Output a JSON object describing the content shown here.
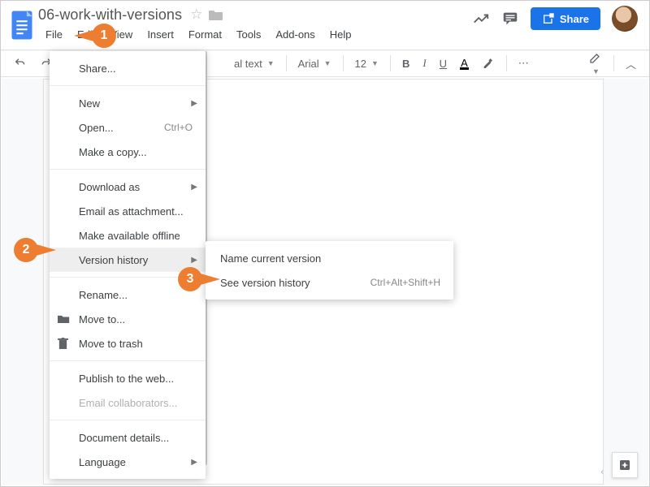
{
  "docTitle": "06-work-with-versions",
  "menubar": [
    "File",
    "Edit",
    "View",
    "Insert",
    "Format",
    "Tools",
    "Add-ons",
    "Help"
  ],
  "share": "Share",
  "toolbar": {
    "style": "al text",
    "font": "Arial",
    "size": "12"
  },
  "fileMenu": [
    {
      "type": "item",
      "label": "Share...",
      "icon": ""
    },
    {
      "type": "divider"
    },
    {
      "type": "item",
      "label": "New",
      "submenu": true
    },
    {
      "type": "item",
      "label": "Open...",
      "shortcut": "Ctrl+O"
    },
    {
      "type": "item",
      "label": "Make a copy..."
    },
    {
      "type": "divider"
    },
    {
      "type": "item",
      "label": "Download as",
      "submenu": true
    },
    {
      "type": "item",
      "label": "Email as attachment..."
    },
    {
      "type": "item",
      "label": "Make available offline"
    },
    {
      "type": "item",
      "label": "Version history",
      "submenu": true,
      "hl": true
    },
    {
      "type": "divider"
    },
    {
      "type": "item",
      "label": "Rename..."
    },
    {
      "type": "item",
      "label": "Move to...",
      "icon": "folder"
    },
    {
      "type": "item",
      "label": "Move to trash",
      "icon": "trash"
    },
    {
      "type": "divider"
    },
    {
      "type": "item",
      "label": "Publish to the web..."
    },
    {
      "type": "item",
      "label": "Email collaborators...",
      "disabled": true
    },
    {
      "type": "divider"
    },
    {
      "type": "item",
      "label": "Document details..."
    },
    {
      "type": "item",
      "label": "Language",
      "submenu": true
    }
  ],
  "submenu": [
    {
      "label": "Name current version"
    },
    {
      "label": "See version history",
      "shortcut": "Ctrl+Alt+Shift+H"
    }
  ],
  "callouts": {
    "1": "1",
    "2": "2",
    "3": "3"
  }
}
